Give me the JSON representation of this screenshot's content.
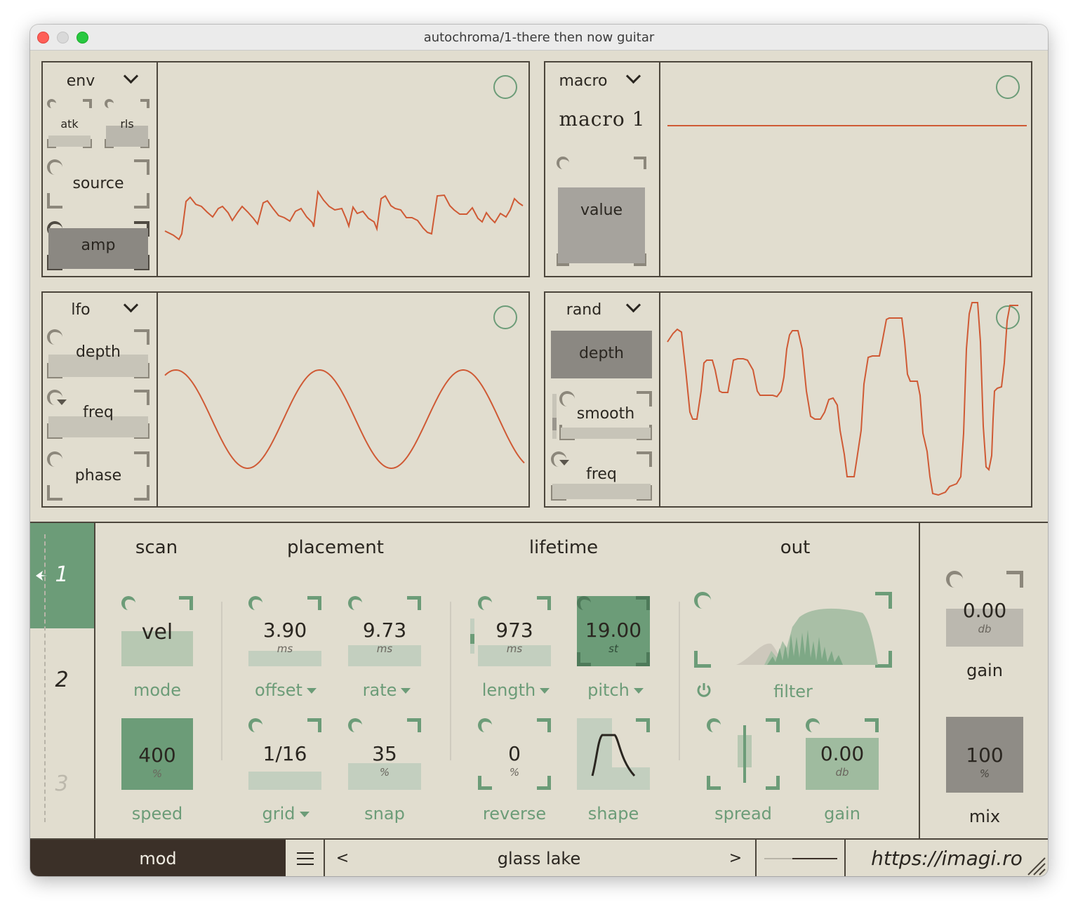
{
  "window": {
    "title": "autochroma/1-there then now guitar"
  },
  "env": {
    "title": "env",
    "atk": "atk",
    "rls": "rls",
    "source": "source",
    "amp": "amp"
  },
  "macro": {
    "title": "macro",
    "name": "macro 1",
    "value": "value"
  },
  "lfo": {
    "title": "lfo",
    "depth": "depth",
    "freq": "freq",
    "phase": "phase"
  },
  "rand": {
    "title": "rand",
    "depth": "depth",
    "smooth": "smooth",
    "freq": "freq"
  },
  "layers": {
    "items": [
      "1",
      "2",
      "3"
    ],
    "selected": "1"
  },
  "sections": {
    "scan": "scan",
    "placement": "placement",
    "lifetime": "lifetime",
    "out": "out"
  },
  "scan": {
    "mode": {
      "value": "vel",
      "label": "mode"
    },
    "speed": {
      "value": "400",
      "unit": "%",
      "label": "speed"
    }
  },
  "placement": {
    "offset": {
      "value": "3.90",
      "unit": "ms",
      "label": "offset"
    },
    "rate": {
      "value": "9.73",
      "unit": "ms",
      "label": "rate"
    },
    "grid": {
      "value": "1/16",
      "label": "grid"
    },
    "snap": {
      "value": "35",
      "unit": "%",
      "label": "snap"
    }
  },
  "lifetime": {
    "length": {
      "value": "973",
      "unit": "ms",
      "label": "length"
    },
    "pitch": {
      "value": "19.00",
      "unit": "st",
      "label": "pitch"
    },
    "reverse": {
      "value": "0",
      "unit": "%",
      "label": "reverse"
    },
    "shape": {
      "label": "shape"
    }
  },
  "out": {
    "filter": {
      "label": "filter",
      "power_icon": "power-icon"
    },
    "spread": {
      "label": "spread"
    },
    "gain": {
      "value": "0.00",
      "unit": "db",
      "label": "gain"
    }
  },
  "master": {
    "gain": {
      "value": "0.00",
      "unit": "db",
      "label": "gain"
    },
    "mix": {
      "value": "100",
      "unit": "%",
      "label": "mix"
    }
  },
  "footer": {
    "mod": "mod",
    "menu_icon": "hamburger-icon",
    "prev": "<",
    "preset": "glass lake",
    "next": ">",
    "url": "https://imagi.ro"
  },
  "colors": {
    "background": "#e1ddcf",
    "accent_green": "#6c9c78",
    "curve_orange": "#cf5a35",
    "panel_border": "#4c463c",
    "footer_dark": "#3b3028"
  }
}
